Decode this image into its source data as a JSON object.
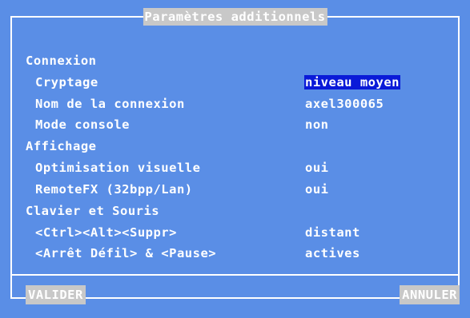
{
  "dialog": {
    "title": "Paramètres additionnels"
  },
  "sections": [
    {
      "heading": "Connexion",
      "rows": [
        {
          "label": "Cryptage",
          "value": "niveau moyen",
          "selected": true
        },
        {
          "label": "Nom de la connexion",
          "value": "axel300065"
        },
        {
          "label": "Mode console",
          "value": "non"
        }
      ]
    },
    {
      "heading": "Affichage",
      "rows": [
        {
          "label": "Optimisation visuelle",
          "value": "oui"
        },
        {
          "label": "RemoteFX (32bpp/Lan)",
          "value": "oui"
        }
      ]
    },
    {
      "heading": "Clavier et Souris",
      "rows": [
        {
          "label": "<Ctrl><Alt><Suppr>",
          "value": "distant"
        },
        {
          "label": "<Arrêt Défil> & <Pause>",
          "value": "actives"
        }
      ]
    }
  ],
  "buttons": {
    "validate_label": "VALIDER",
    "cancel_label": "ANNULER"
  },
  "colors": {
    "background": "#5a8ee6",
    "selection": "#0a1ad8",
    "button_bg": "#c8c8c8",
    "text": "#ffffff"
  }
}
